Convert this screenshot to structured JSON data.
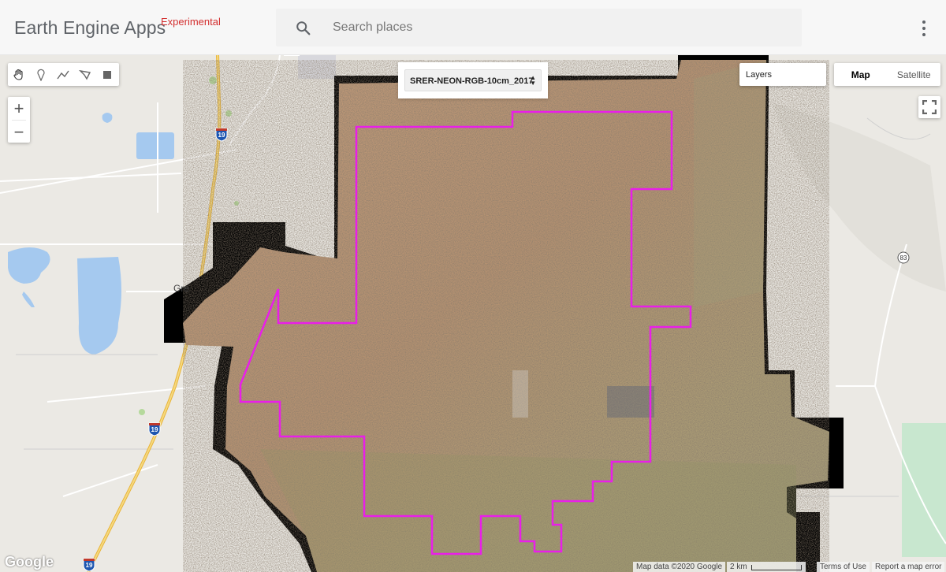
{
  "app": {
    "title": "Earth Engine Apps",
    "badge": "Experimental"
  },
  "search": {
    "placeholder": "Search places",
    "icon": "search-icon"
  },
  "menu_icon": "more-vert-icon",
  "map": {
    "drawing_tools": [
      {
        "name": "hand-pan-icon"
      },
      {
        "name": "marker-icon"
      },
      {
        "name": "line-icon"
      },
      {
        "name": "polygon-icon"
      },
      {
        "name": "rectangle-icon"
      }
    ],
    "zoom_in": "+",
    "zoom_out": "−",
    "dataset_select": "SRER-NEON-RGB-10cm_2017",
    "layers_label": "Layers",
    "map_types": [
      "Map",
      "Satellite"
    ],
    "active_map_type": "Map",
    "place_label": "Gre",
    "highway_shields": [
      "19",
      "19",
      "19",
      "83"
    ],
    "logo_text": "Google",
    "attribution": "Map data ©2020 Google",
    "scale_label": "2 km",
    "terms_link": "Terms of Use",
    "report_link": "Report a map error",
    "colors": {
      "boundary": "#e91ee9",
      "imagery": "#b09373",
      "highway": "#f6c64e",
      "water": "#a5c9ef",
      "park": "#c8e7cf"
    }
  }
}
